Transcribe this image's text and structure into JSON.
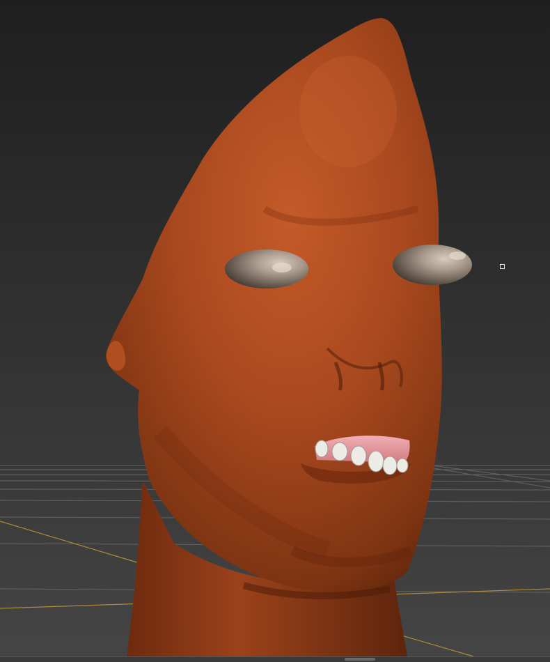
{
  "viewport": {
    "background_top": "#1f1f1f",
    "background_bottom": "#3d3d3d",
    "grid_color": "#6f6f6f",
    "axis_color": "#b08a3a"
  },
  "model": {
    "skin_color": "#a9491f",
    "skin_shadow": "#6e2a0e",
    "eye_color": "#a89a8c",
    "gum_color": "#e89aa0",
    "teeth_color": "#ecebe6"
  },
  "icons": {
    "pivot": "transform-pivot-icon"
  }
}
